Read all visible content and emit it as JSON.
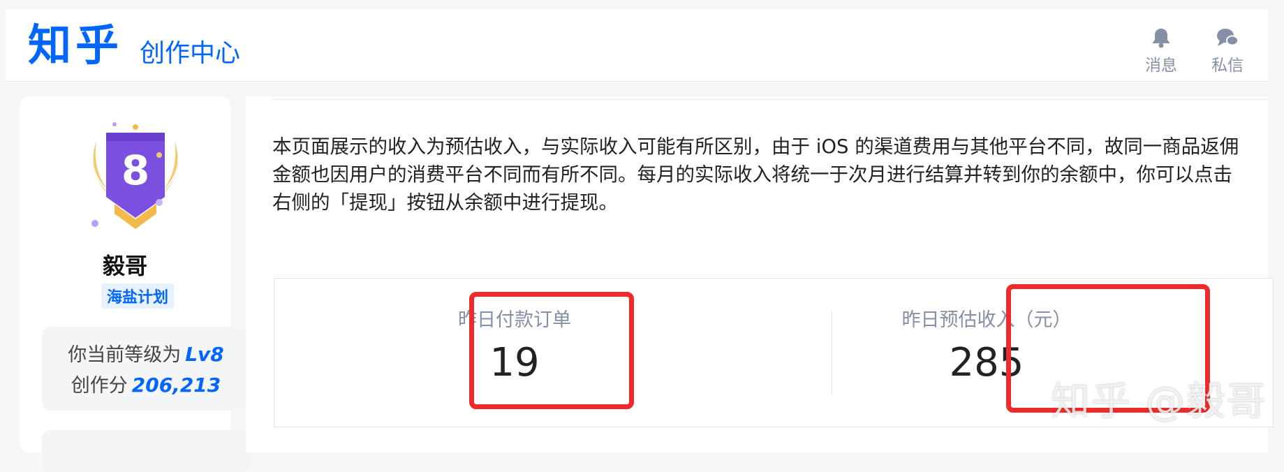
{
  "header": {
    "logo": "知乎",
    "subtitle": "创作中心",
    "messages_label": "消息",
    "dm_label": "私信"
  },
  "sidebar": {
    "badge_level": "8",
    "username": "毅哥",
    "plan": "海盐计划",
    "level_prefix": "你当前等级为",
    "level_value": "Lv8",
    "score_prefix": "创作分",
    "score_value": "206,213"
  },
  "main": {
    "notice": "本页面展示的收入为预估收入，与实际收入可能有所区别，由于 iOS 的渠道费用与其他平台不同，故同一商品返佣金额也因用户的消费平台不同而有所不同。每月的实际收入将统一于次月进行结算并转到你的余额中，你可以点击右侧的「提现」按钮从余额中进行提现。",
    "stats": [
      {
        "label": "昨日付款订单",
        "value": "19"
      },
      {
        "label": "昨日预估收入（元）",
        "value": "285"
      }
    ]
  },
  "watermark": "知乎 @毅哥",
  "colors": {
    "brand": "#0066ff",
    "highlight": "#f02a2a"
  }
}
